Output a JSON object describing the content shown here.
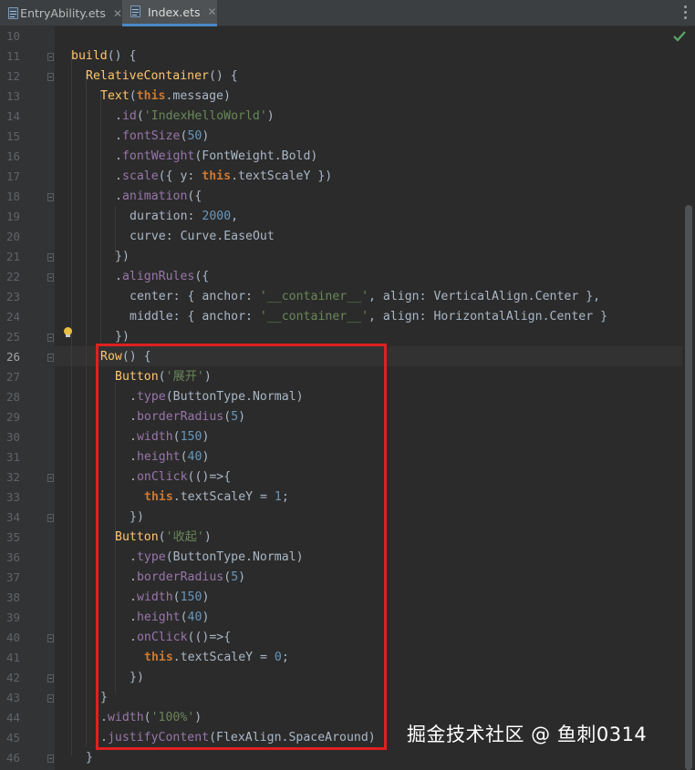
{
  "tabs": [
    {
      "label": "EntryAbility.ets",
      "active": false
    },
    {
      "label": "Index.ets",
      "active": true
    }
  ],
  "editor": {
    "current_line": 26,
    "lines": [
      {
        "n": 10,
        "tokens": []
      },
      {
        "n": 11,
        "tokens": [
          [
            "fn",
            "build"
          ],
          [
            "plain",
            "() {"
          ]
        ]
      },
      {
        "n": 12,
        "tokens": [
          [
            "fn",
            "RelativeContainer"
          ],
          [
            "plain",
            "() {"
          ]
        ]
      },
      {
        "n": 13,
        "tokens": [
          [
            "fn",
            "Text"
          ],
          [
            "plain",
            "("
          ],
          [
            "kw",
            "this"
          ],
          [
            "plain",
            ".message)"
          ]
        ]
      },
      {
        "n": 14,
        "tokens": [
          [
            "plain",
            "."
          ],
          [
            "mc",
            "id"
          ],
          [
            "plain",
            "("
          ],
          [
            "str",
            "'IndexHelloWorld'"
          ],
          [
            "plain",
            ")"
          ]
        ]
      },
      {
        "n": 15,
        "tokens": [
          [
            "plain",
            "."
          ],
          [
            "mc",
            "fontSize"
          ],
          [
            "plain",
            "("
          ],
          [
            "num",
            "50"
          ],
          [
            "plain",
            ")"
          ]
        ]
      },
      {
        "n": 16,
        "tokens": [
          [
            "plain",
            "."
          ],
          [
            "mc",
            "fontWeight"
          ],
          [
            "plain",
            "(FontWeight.Bold)"
          ]
        ]
      },
      {
        "n": 17,
        "tokens": [
          [
            "plain",
            "."
          ],
          [
            "mc",
            "scale"
          ],
          [
            "plain",
            "({ y: "
          ],
          [
            "kw",
            "this"
          ],
          [
            "plain",
            ".textScaleY })"
          ]
        ]
      },
      {
        "n": 18,
        "tokens": [
          [
            "plain",
            "."
          ],
          [
            "mc",
            "animation"
          ],
          [
            "plain",
            "({"
          ]
        ]
      },
      {
        "n": 19,
        "tokens": [
          [
            "plain",
            "duration: "
          ],
          [
            "num",
            "2000"
          ],
          [
            "plain",
            ","
          ]
        ]
      },
      {
        "n": 20,
        "tokens": [
          [
            "plain",
            "curve: Curve.EaseOut"
          ]
        ]
      },
      {
        "n": 21,
        "tokens": [
          [
            "plain",
            "})"
          ]
        ]
      },
      {
        "n": 22,
        "tokens": [
          [
            "plain",
            "."
          ],
          [
            "mc",
            "alignRules"
          ],
          [
            "plain",
            "({"
          ]
        ]
      },
      {
        "n": 23,
        "tokens": [
          [
            "plain",
            "center: { anchor: "
          ],
          [
            "str",
            "'__container__'"
          ],
          [
            "plain",
            ", align: VerticalAlign.Center },"
          ]
        ]
      },
      {
        "n": 24,
        "tokens": [
          [
            "plain",
            "middle: { anchor: "
          ],
          [
            "str",
            "'__container__'"
          ],
          [
            "plain",
            ", align: HorizontalAlign.Center }"
          ]
        ]
      },
      {
        "n": 25,
        "tokens": [
          [
            "plain",
            "})"
          ]
        ]
      },
      {
        "n": 26,
        "tokens": [
          [
            "fn",
            "Row"
          ],
          [
            "plain",
            "() {"
          ]
        ]
      },
      {
        "n": 27,
        "tokens": [
          [
            "fn",
            "Button"
          ],
          [
            "plain",
            "("
          ],
          [
            "str",
            "'展开'"
          ],
          [
            "plain",
            ")"
          ]
        ]
      },
      {
        "n": 28,
        "tokens": [
          [
            "plain",
            "."
          ],
          [
            "mc",
            "type"
          ],
          [
            "plain",
            "(ButtonType.Normal)"
          ]
        ]
      },
      {
        "n": 29,
        "tokens": [
          [
            "plain",
            "."
          ],
          [
            "mc",
            "borderRadius"
          ],
          [
            "plain",
            "("
          ],
          [
            "num",
            "5"
          ],
          [
            "plain",
            ")"
          ]
        ]
      },
      {
        "n": 30,
        "tokens": [
          [
            "plain",
            "."
          ],
          [
            "mc",
            "width"
          ],
          [
            "plain",
            "("
          ],
          [
            "num",
            "150"
          ],
          [
            "plain",
            ")"
          ]
        ]
      },
      {
        "n": 31,
        "tokens": [
          [
            "plain",
            "."
          ],
          [
            "mc",
            "height"
          ],
          [
            "plain",
            "("
          ],
          [
            "num",
            "40"
          ],
          [
            "plain",
            ")"
          ]
        ]
      },
      {
        "n": 32,
        "tokens": [
          [
            "plain",
            "."
          ],
          [
            "mc",
            "onClick"
          ],
          [
            "plain",
            "(()=>{"
          ]
        ]
      },
      {
        "n": 33,
        "tokens": [
          [
            "kw",
            "this"
          ],
          [
            "plain",
            ".textScaleY = "
          ],
          [
            "num",
            "1"
          ],
          [
            "plain",
            ";"
          ]
        ]
      },
      {
        "n": 34,
        "tokens": [
          [
            "plain",
            "})"
          ]
        ]
      },
      {
        "n": 35,
        "tokens": [
          [
            "fn",
            "Button"
          ],
          [
            "plain",
            "("
          ],
          [
            "str",
            "'收起'"
          ],
          [
            "plain",
            ")"
          ]
        ]
      },
      {
        "n": 36,
        "tokens": [
          [
            "plain",
            "."
          ],
          [
            "mc",
            "type"
          ],
          [
            "plain",
            "(ButtonType.Normal)"
          ]
        ]
      },
      {
        "n": 37,
        "tokens": [
          [
            "plain",
            "."
          ],
          [
            "mc",
            "borderRadius"
          ],
          [
            "plain",
            "("
          ],
          [
            "num",
            "5"
          ],
          [
            "plain",
            ")"
          ]
        ]
      },
      {
        "n": 38,
        "tokens": [
          [
            "plain",
            "."
          ],
          [
            "mc",
            "width"
          ],
          [
            "plain",
            "("
          ],
          [
            "num",
            "150"
          ],
          [
            "plain",
            ")"
          ]
        ]
      },
      {
        "n": 39,
        "tokens": [
          [
            "plain",
            "."
          ],
          [
            "mc",
            "height"
          ],
          [
            "plain",
            "("
          ],
          [
            "num",
            "40"
          ],
          [
            "plain",
            ")"
          ]
        ]
      },
      {
        "n": 40,
        "tokens": [
          [
            "plain",
            "."
          ],
          [
            "mc",
            "onClick"
          ],
          [
            "plain",
            "(()=>{"
          ]
        ]
      },
      {
        "n": 41,
        "tokens": [
          [
            "kw",
            "this"
          ],
          [
            "plain",
            ".textScaleY = "
          ],
          [
            "num",
            "0"
          ],
          [
            "plain",
            ";"
          ]
        ]
      },
      {
        "n": 42,
        "tokens": [
          [
            "plain",
            "})"
          ]
        ]
      },
      {
        "n": 43,
        "tokens": [
          [
            "plain",
            "}"
          ]
        ]
      },
      {
        "n": 44,
        "tokens": [
          [
            "plain",
            "."
          ],
          [
            "mc",
            "width"
          ],
          [
            "plain",
            "("
          ],
          [
            "str",
            "'100%'"
          ],
          [
            "plain",
            ")"
          ]
        ]
      },
      {
        "n": 45,
        "tokens": [
          [
            "plain",
            "."
          ],
          [
            "mc",
            "justifyContent"
          ],
          [
            "plain",
            "(FlexAlign.SpaceAround)"
          ]
        ]
      },
      {
        "n": 46,
        "tokens": [
          [
            "plain",
            "}"
          ]
        ]
      }
    ]
  },
  "colors": {
    "background": "#2b2b2b",
    "gutter": "#313335",
    "keyword": "#cc7832",
    "function": "#ffc66d",
    "string": "#6a8759",
    "number": "#6897bb",
    "method": "#9876aa",
    "highlight_box": "#e02020"
  },
  "icons": {
    "file_icon": "ets-file-icon",
    "close_icon": "close-icon",
    "menu_icon": "more-vertical-icon",
    "status_icon": "check-icon",
    "intention_icon": "lightbulb-icon"
  },
  "watermark": "掘金技术社区 @ 鱼刺0314"
}
